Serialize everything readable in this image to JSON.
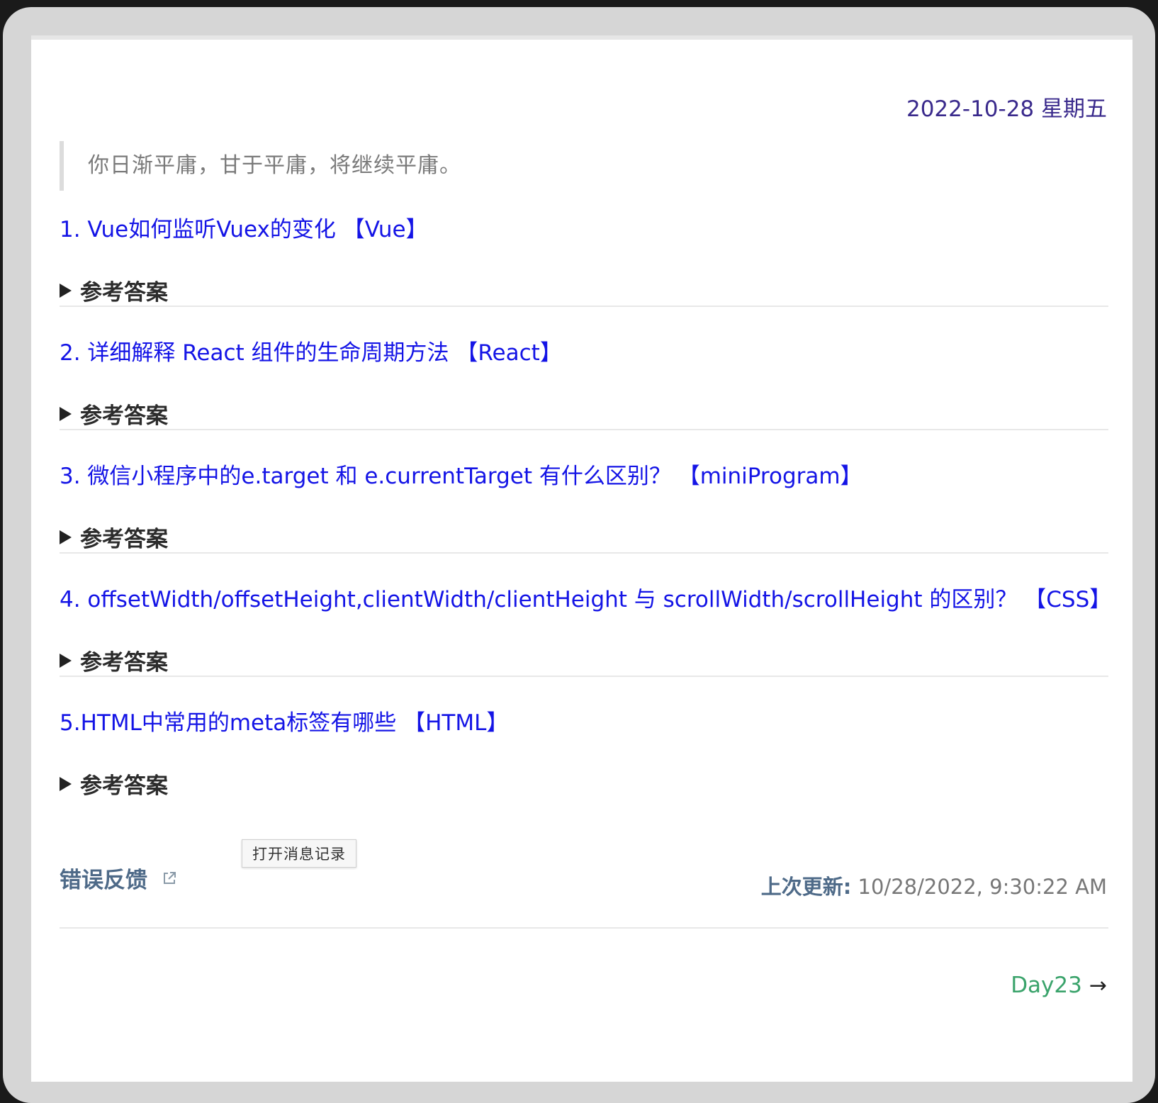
{
  "date": "2022-10-28 星期五",
  "quote": "你日渐平庸，甘于平庸，将继续平庸。",
  "questions": [
    {
      "title": "1. Vue如何监听Vuex的变化  【Vue】",
      "answer_label": "参考答案"
    },
    {
      "title": "2. 详细解释 React 组件的生命周期方法  【React】",
      "answer_label": "参考答案"
    },
    {
      "title": "3. 微信小程序中的e.target 和 e.currentTarget 有什么区别？  【miniProgram】",
      "answer_label": "参考答案"
    },
    {
      "title": "4. offsetWidth/offsetHeight,clientWidth/clientHeight 与 scrollWidth/scrollHeight 的区别？  【CSS】",
      "answer_label": "参考答案"
    },
    {
      "title": "5.HTML中常用的meta标签有哪些  【HTML】",
      "answer_label": "参考答案"
    }
  ],
  "tooltip": "打开消息记录",
  "footer": {
    "feedback": "错误反馈",
    "updated_label": "上次更新:",
    "updated_value": " 10/28/2022, 9:30:22 AM"
  },
  "next_link": "Day23",
  "colors": {
    "link": "#1414e6",
    "date": "#3a2a8c",
    "next": "#3aa36b",
    "footer": "#4e6a88"
  }
}
